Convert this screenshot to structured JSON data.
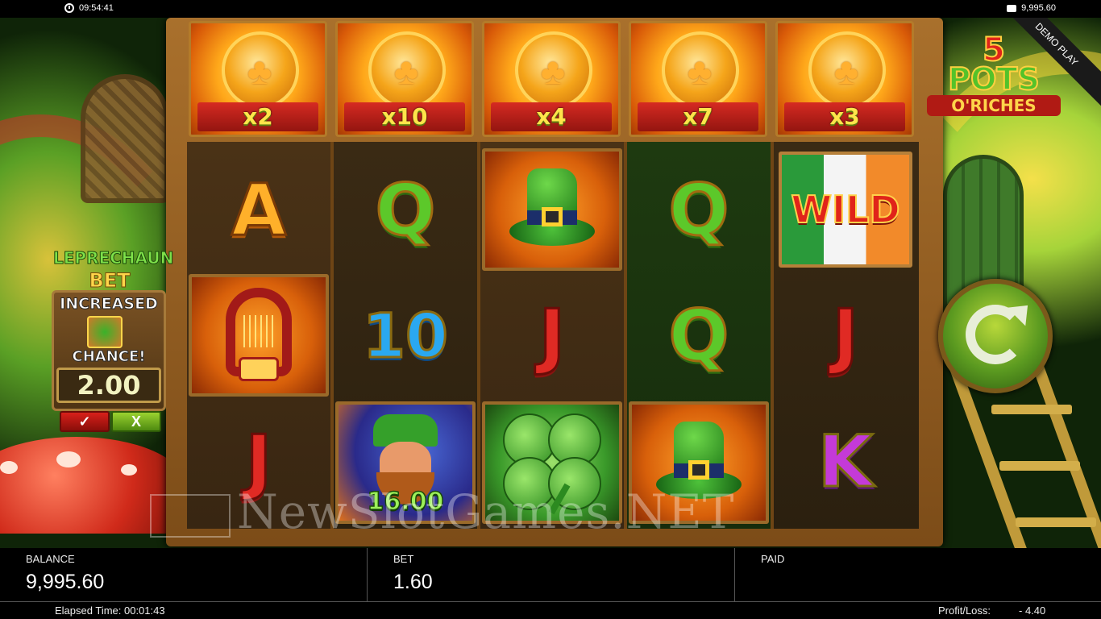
{
  "status_bar": {
    "time": "09:54:41",
    "balance_display": "9,995.60",
    "clock_icon": "clock-icon",
    "wallet_icon": "wallet-icon"
  },
  "game": {
    "logo": {
      "number": "5",
      "line1": "POTS",
      "line2": "O'RICHES"
    },
    "demo_ribbon": "DEMO PLAY",
    "pots": [
      {
        "multiplier": "x2"
      },
      {
        "multiplier": "x10"
      },
      {
        "multiplier": "x4"
      },
      {
        "multiplier": "x7"
      },
      {
        "multiplier": "x3"
      }
    ],
    "reels": [
      [
        "A",
        "harp",
        "J"
      ],
      [
        "Q",
        "10",
        "leprechaun"
      ],
      [
        "hat",
        "J",
        "clover"
      ],
      [
        "Q",
        "Q",
        "hat"
      ],
      [
        "WILD",
        "J",
        "K"
      ]
    ],
    "leprechaun_symbol_value": "16.00",
    "wild_label": "WILD",
    "spin_icon": "spin-arrow-icon"
  },
  "leprechaun_bet": {
    "title_line1": "LEPRECHAUN",
    "title_line2": "BET",
    "increased": "INCREASED",
    "chance": "CHANCE!",
    "value": "2.00",
    "confirm_label": "✓",
    "cancel_label": "X"
  },
  "watermark": "NewSlotGames.NET",
  "info_bar": {
    "balance_label": "BALANCE",
    "balance_value": "9,995.60",
    "bet_label": "BET",
    "bet_value": "1.60",
    "paid_label": "PAID",
    "paid_value": ""
  },
  "footer": {
    "elapsed": "Elapsed Time: 00:01:43",
    "profit_loss_label": "Profit/Loss:",
    "profit_loss_value": "- 4.40"
  }
}
